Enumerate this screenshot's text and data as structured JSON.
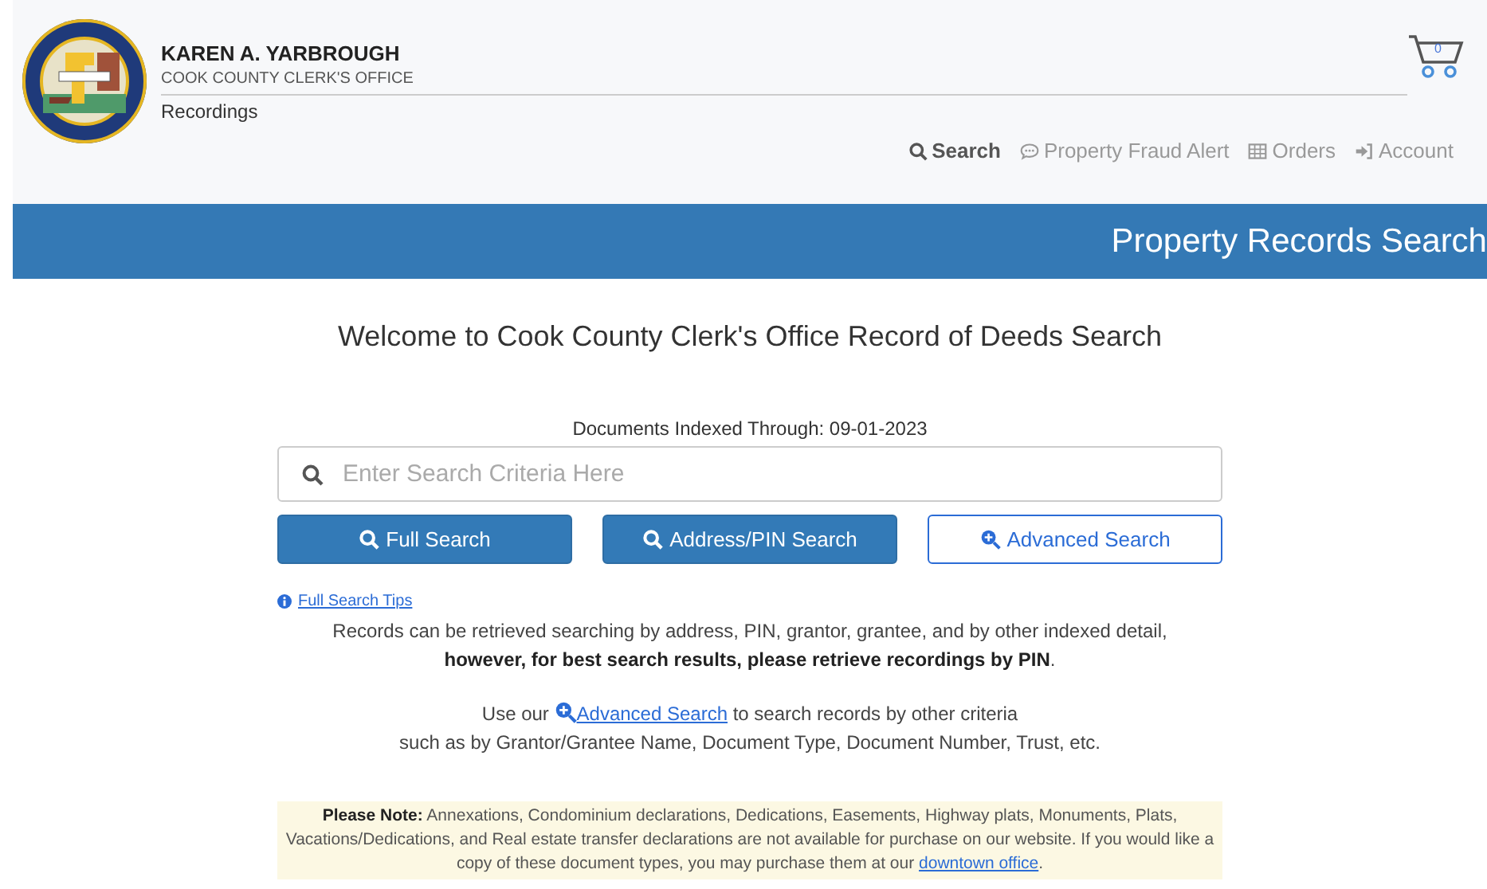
{
  "header": {
    "name": "KAREN A. YARBROUGH",
    "office": "COOK COUNTY CLERK'S OFFICE",
    "section": "Recordings",
    "cart_count": "0"
  },
  "nav": [
    {
      "label": "Search",
      "selected": true
    },
    {
      "label": "Property Fraud Alert",
      "selected": false
    },
    {
      "label": "Orders",
      "selected": false
    },
    {
      "label": "Account",
      "selected": false
    }
  ],
  "banner": "Property Records Search",
  "welcome": "Welcome to Cook County Clerk's Office Record of Deeds Search",
  "indexed": "Documents Indexed Through: 09-01-2023",
  "search": {
    "placeholder": "Enter Search Criteria Here"
  },
  "buttons": [
    {
      "label": "Full Search",
      "kind": "primary"
    },
    {
      "label": "Address/PIN Search",
      "kind": "primary"
    },
    {
      "label": "Advanced Search",
      "kind": "outline"
    }
  ],
  "tips_link": "Full Search Tips",
  "records_note": [
    "Records can be retrieved searching by address, PIN, grantor, grantee, and by other indexed detail,",
    "**however, for best search results, please retrieve recordings by PIN**."
  ],
  "advanced_note": {
    "before": "Use our",
    "link": "Advanced Search",
    "after": "to search records by other criteria",
    "line2": "such as by Grantor/Grantee Name, Document Type, Document Number, Trust, etc."
  },
  "please_note": {
    "label": "Please Note:",
    "text": "Annexations, Condominium declarations, Dedications, Easements, Highway plats, Monuments, Plats, Vacations/Dedications, and Real estate transfer declarations are not available for purchase on our website. If you would like a copy of these document types, you may purchase them at our",
    "link": "downtown office",
    "end": "."
  }
}
